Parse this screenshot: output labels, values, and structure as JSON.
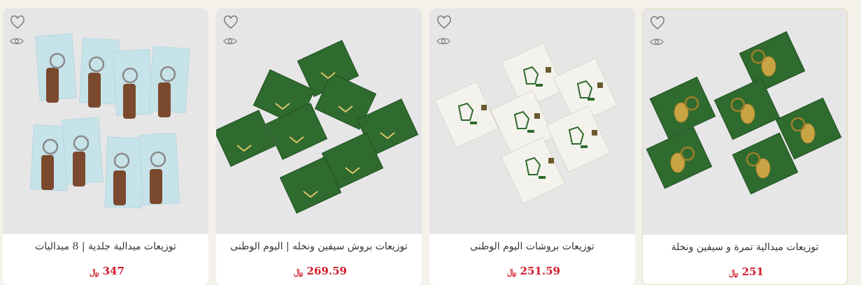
{
  "products": [
    {
      "title": "توزيعات ميدالية جلدية | 8 ميداليات",
      "price": "347",
      "currency": "﷼",
      "image": "leather-keychain-cards-photo"
    },
    {
      "title": "توزيعات بروش سيفين ونخله | اليوم الوطنى",
      "price": "269.59",
      "currency": "﷼",
      "image": "green-brooch-cards-photo"
    },
    {
      "title": "توزيعات بروشات اليوم الوطنى",
      "price": "251.59",
      "currency": "﷼",
      "image": "white-brooch-cards-photo"
    },
    {
      "title": "توزيعات ميدالية تمرة و سيفين ونخلة",
      "price": "251",
      "currency": "﷼",
      "image": "gold-keychain-cards-photo"
    }
  ],
  "colors": {
    "price": "#d11a2a",
    "green_card": "#2f6b2e",
    "gold": "#c9a445"
  },
  "icons": {
    "wishlist": "heart-icon",
    "quick_view": "eye-icon"
  }
}
